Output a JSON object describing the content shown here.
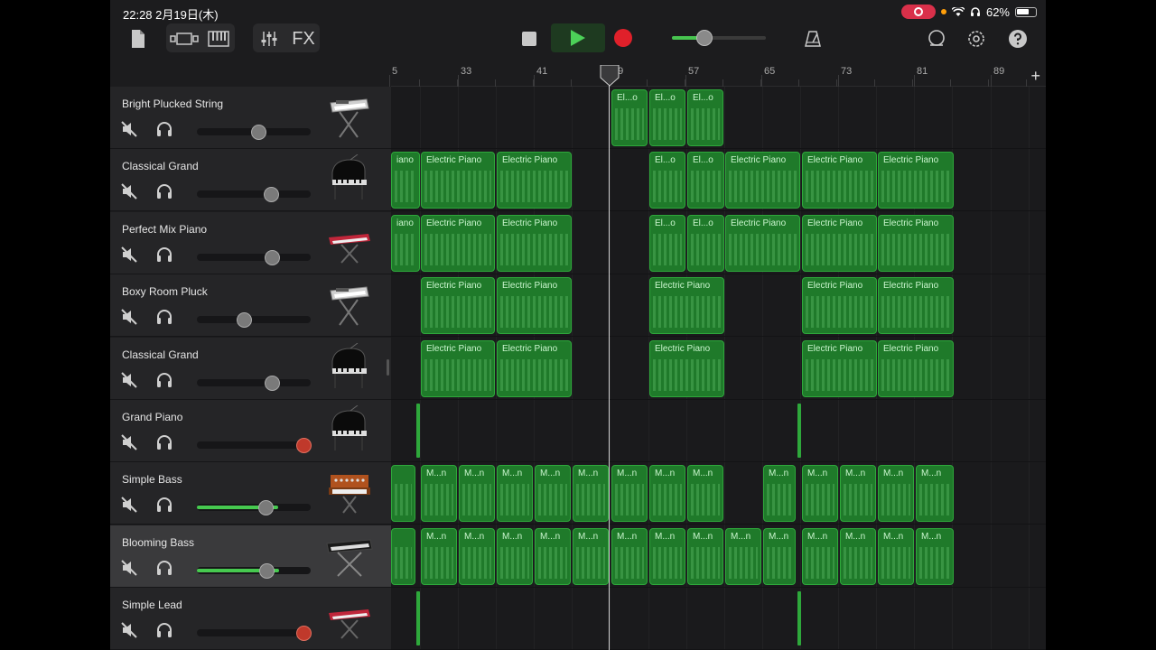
{
  "status_bar": {
    "time": "22:28",
    "date": "2月19日(木)",
    "battery": "62%"
  },
  "toolbar": {
    "fx_label": "FX",
    "master_volume": 0.35
  },
  "ruler": {
    "markers": [
      "5",
      "33",
      "41",
      "49",
      "57",
      "65",
      "73",
      "81",
      "89"
    ]
  },
  "tracks": [
    {
      "name": "Bright Plucked String",
      "volume": 0.54,
      "muted": true,
      "instrument": "keyboard-stand-icon",
      "selected": false
    },
    {
      "name": "Classical Grand",
      "volume": 0.65,
      "muted": true,
      "instrument": "grand-piano-icon",
      "selected": false
    },
    {
      "name": "Perfect Mix Piano",
      "volume": 0.66,
      "muted": true,
      "instrument": "red-keyboard-icon",
      "selected": false
    },
    {
      "name": "Boxy Room Pluck",
      "volume": 0.41,
      "muted": true,
      "instrument": "keyboard-stand-icon",
      "selected": false
    },
    {
      "name": "Classical Grand",
      "volume": 0.66,
      "muted": true,
      "instrument": "grand-piano-icon",
      "selected": false
    },
    {
      "name": "Grand Piano",
      "volume": 0.94,
      "muted": true,
      "instrument": "grand-piano-icon",
      "selected": false
    },
    {
      "name": "Simple Bass",
      "volume": 0.6,
      "muted": true,
      "instrument": "synth-icon",
      "selected": false
    },
    {
      "name": "Blooming Bass",
      "volume": 0.61,
      "muted": true,
      "instrument": "synth-stand-icon",
      "selected": true
    },
    {
      "name": "Simple Lead",
      "volume": 0.94,
      "muted": true,
      "instrument": "red-keyboard-icon",
      "selected": false
    }
  ],
  "regions": [
    [
      {
        "label": "El...o"
      },
      {
        "label": "El...o"
      },
      {
        "label": "El...o"
      }
    ],
    [
      {
        "label": "iano"
      },
      {
        "label": "Electric Piano"
      },
      {
        "label": "Electric Piano"
      },
      {
        "label": "El...o"
      },
      {
        "label": "El...o"
      },
      {
        "label": "Electric Piano"
      },
      {
        "label": "Electric Piano"
      },
      {
        "label": "Electric Piano"
      }
    ],
    [
      {
        "label": "iano"
      },
      {
        "label": "Electric Piano"
      },
      {
        "label": "Electric Piano"
      },
      {
        "label": "El...o"
      },
      {
        "label": "El...o"
      },
      {
        "label": "Electric Piano"
      },
      {
        "label": "Electric Piano"
      },
      {
        "label": "Electric Piano"
      }
    ],
    [
      {
        "label": "Electric Piano"
      },
      {
        "label": "Electric Piano"
      },
      {
        "label": "Electric Piano"
      },
      {
        "label": "Electric Piano"
      },
      {
        "label": "Electric Piano"
      }
    ],
    [
      {
        "label": "Electric Piano"
      },
      {
        "label": "Electric Piano"
      },
      {
        "label": "Electric Piano"
      },
      {
        "label": "Electric Piano"
      },
      {
        "label": "Electric Piano"
      }
    ],
    [],
    [
      {
        "label": ""
      },
      {
        "label": "M...n"
      },
      {
        "label": "M...n"
      },
      {
        "label": "M...n"
      },
      {
        "label": "M...n"
      },
      {
        "label": "M...n"
      },
      {
        "label": "M...n"
      },
      {
        "label": "M...n"
      },
      {
        "label": "M...n"
      },
      {
        "label": "M...n"
      },
      {
        "label": "M...n"
      },
      {
        "label": "M...n"
      },
      {
        "label": "M...n"
      },
      {
        "label": "M...n"
      }
    ],
    [
      {
        "label": ""
      },
      {
        "label": "M...n"
      },
      {
        "label": "M...n"
      },
      {
        "label": "M...n"
      },
      {
        "label": "M...n"
      },
      {
        "label": "M...n"
      },
      {
        "label": "M...n"
      },
      {
        "label": "M...n"
      },
      {
        "label": "M...n"
      },
      {
        "label": "M...n"
      },
      {
        "label": "M...n"
      },
      {
        "label": "M...n"
      },
      {
        "label": "M...n"
      },
      {
        "label": "M...n"
      },
      {
        "label": "M...n"
      }
    ],
    []
  ]
}
